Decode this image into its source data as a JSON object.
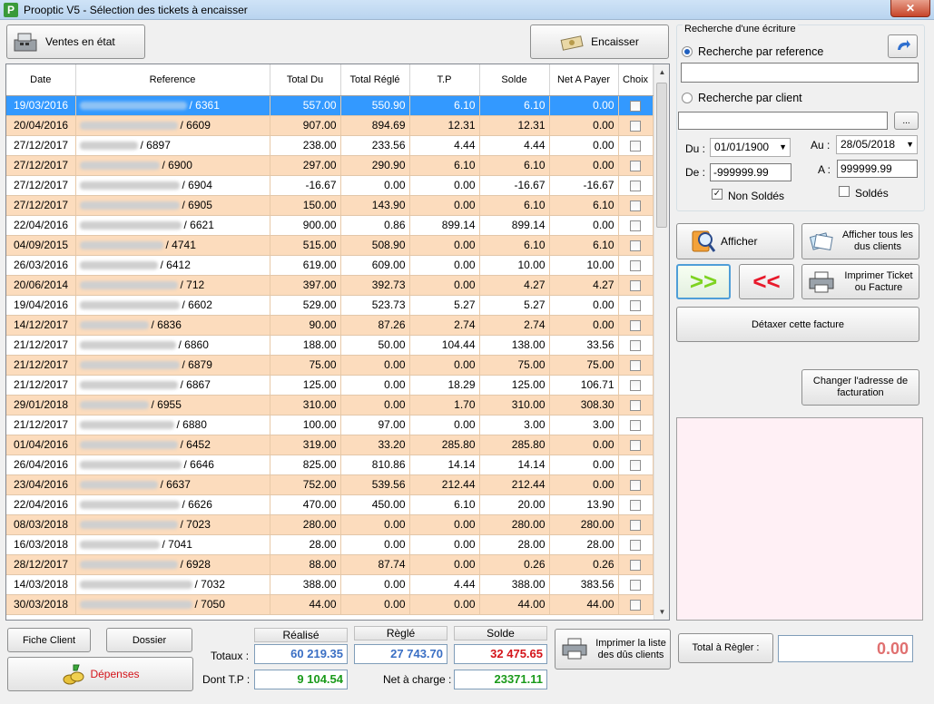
{
  "window": {
    "title": "Prooptic V5 - Sélection des tickets à encaisser",
    "app_icon": "P",
    "close": "✕"
  },
  "buttons": {
    "ventes_en_etat": "Ventes en état",
    "encaisser": "Encaisser",
    "afficher": "Afficher",
    "afficher_tous": "Afficher tous les dus clients",
    "forward": ">>",
    "back": "<<",
    "imprimer_ticket": "Imprimer Ticket ou Facture",
    "detaxer": "Détaxer cette facture",
    "changer_adresse": "Changer l'adresse de facturation",
    "fiche_client": "Fiche Client",
    "dossier": "Dossier",
    "depenses": "Dépenses",
    "imprimer_liste": "Imprimer la liste des dûs clients",
    "browse": "..."
  },
  "grid": {
    "columns": [
      "Date",
      "Reference",
      "Total Du",
      "Total Réglé",
      "T.P",
      "Solde",
      "Net A Payer",
      "Choix"
    ],
    "rows": [
      {
        "date": "19/03/2016",
        "ref": "/ 6361",
        "total_du": "557.00",
        "total_regle": "550.90",
        "tp": "6.10",
        "solde": "6.10",
        "net": "0.00"
      },
      {
        "date": "20/04/2016",
        "ref": "/ 6609",
        "total_du": "907.00",
        "total_regle": "894.69",
        "tp": "12.31",
        "solde": "12.31",
        "net": "0.00"
      },
      {
        "date": "27/12/2017",
        "ref": "/ 6897",
        "total_du": "238.00",
        "total_regle": "233.56",
        "tp": "4.44",
        "solde": "4.44",
        "net": "0.00"
      },
      {
        "date": "27/12/2017",
        "ref": "/ 6900",
        "total_du": "297.00",
        "total_regle": "290.90",
        "tp": "6.10",
        "solde": "6.10",
        "net": "0.00"
      },
      {
        "date": "27/12/2017",
        "ref": "/ 6904",
        "total_du": "-16.67",
        "total_regle": "0.00",
        "tp": "0.00",
        "solde": "-16.67",
        "net": "-16.67"
      },
      {
        "date": "27/12/2017",
        "ref": "/ 6905",
        "total_du": "150.00",
        "total_regle": "143.90",
        "tp": "0.00",
        "solde": "6.10",
        "net": "6.10"
      },
      {
        "date": "22/04/2016",
        "ref": "/ 6621",
        "total_du": "900.00",
        "total_regle": "0.86",
        "tp": "899.14",
        "solde": "899.14",
        "net": "0.00"
      },
      {
        "date": "04/09/2015",
        "ref": "/ 4741",
        "total_du": "515.00",
        "total_regle": "508.90",
        "tp": "0.00",
        "solde": "6.10",
        "net": "6.10"
      },
      {
        "date": "26/03/2016",
        "ref": "/ 6412",
        "total_du": "619.00",
        "total_regle": "609.00",
        "tp": "0.00",
        "solde": "10.00",
        "net": "10.00"
      },
      {
        "date": "20/06/2014",
        "ref": "/ 712",
        "total_du": "397.00",
        "total_regle": "392.73",
        "tp": "0.00",
        "solde": "4.27",
        "net": "4.27"
      },
      {
        "date": "19/04/2016",
        "ref": "/ 6602",
        "total_du": "529.00",
        "total_regle": "523.73",
        "tp": "5.27",
        "solde": "5.27",
        "net": "0.00"
      },
      {
        "date": "14/12/2017",
        "ref": "/ 6836",
        "total_du": "90.00",
        "total_regle": "87.26",
        "tp": "2.74",
        "solde": "2.74",
        "net": "0.00"
      },
      {
        "date": "21/12/2017",
        "ref": "/ 6860",
        "total_du": "188.00",
        "total_regle": "50.00",
        "tp": "104.44",
        "solde": "138.00",
        "net": "33.56"
      },
      {
        "date": "21/12/2017",
        "ref": "/ 6879",
        "total_du": "75.00",
        "total_regle": "0.00",
        "tp": "0.00",
        "solde": "75.00",
        "net": "75.00"
      },
      {
        "date": "21/12/2017",
        "ref": "/ 6867",
        "total_du": "125.00",
        "total_regle": "0.00",
        "tp": "18.29",
        "solde": "125.00",
        "net": "106.71"
      },
      {
        "date": "29/01/2018",
        "ref": "/ 6955",
        "total_du": "310.00",
        "total_regle": "0.00",
        "tp": "1.70",
        "solde": "310.00",
        "net": "308.30"
      },
      {
        "date": "21/12/2017",
        "ref": "/ 6880",
        "total_du": "100.00",
        "total_regle": "97.00",
        "tp": "0.00",
        "solde": "3.00",
        "net": "3.00"
      },
      {
        "date": "01/04/2016",
        "ref": "/ 6452",
        "total_du": "319.00",
        "total_regle": "33.20",
        "tp": "285.80",
        "solde": "285.80",
        "net": "0.00"
      },
      {
        "date": "26/04/2016",
        "ref": "/ 6646",
        "total_du": "825.00",
        "total_regle": "810.86",
        "tp": "14.14",
        "solde": "14.14",
        "net": "0.00"
      },
      {
        "date": "23/04/2016",
        "ref": "/ 6637",
        "total_du": "752.00",
        "total_regle": "539.56",
        "tp": "212.44",
        "solde": "212.44",
        "net": "0.00"
      },
      {
        "date": "22/04/2016",
        "ref": "/ 6626",
        "total_du": "470.00",
        "total_regle": "450.00",
        "tp": "6.10",
        "solde": "20.00",
        "net": "13.90"
      },
      {
        "date": "08/03/2018",
        "ref": "/ 7023",
        "total_du": "280.00",
        "total_regle": "0.00",
        "tp": "0.00",
        "solde": "280.00",
        "net": "280.00"
      },
      {
        "date": "16/03/2018",
        "ref": "/ 7041",
        "total_du": "28.00",
        "total_regle": "0.00",
        "tp": "0.00",
        "solde": "28.00",
        "net": "28.00"
      },
      {
        "date": "28/12/2017",
        "ref": "/ 6928",
        "total_du": "88.00",
        "total_regle": "87.74",
        "tp": "0.00",
        "solde": "0.26",
        "net": "0.26"
      },
      {
        "date": "14/03/2018",
        "ref": "/ 7032",
        "total_du": "388.00",
        "total_regle": "0.00",
        "tp": "4.44",
        "solde": "388.00",
        "net": "383.56"
      },
      {
        "date": "30/03/2018",
        "ref": "/ 7050",
        "total_du": "44.00",
        "total_regle": "0.00",
        "tp": "0.00",
        "solde": "44.00",
        "net": "44.00"
      }
    ]
  },
  "search": {
    "group_title": "Recherche d'une écriture",
    "by_reference": "Recherche par reference",
    "by_client": "Recherche par client",
    "reference_value": "",
    "client_value": "",
    "du_label": "Du :",
    "du_value": "01/01/1900",
    "au_label": "Au :",
    "au_value": "28/05/2018",
    "de_label": "De :",
    "de_value": "-999999.99",
    "a_label": "A :",
    "a_value": "999999.99",
    "non_soldes": "Non Soldés",
    "non_soldes_checked": "✓",
    "soldes": "Soldés"
  },
  "totals": {
    "realise_label": "Réalisé",
    "regle_label": "Règlé",
    "solde_label": "Solde",
    "totaux_label": "Totaux :",
    "realise_value": "60 219.35",
    "regle_value": "27 743.70",
    "solde_value": "32 475.65",
    "dont_tp_label": "Dont T.P :",
    "dont_tp_value": "9 104.54",
    "net_charge_label": "Net à charge :",
    "net_charge_value": "23371.11",
    "total_a_regler_label": "Total à Règler :",
    "total_a_regler_value": "0.00"
  },
  "colors": {
    "row_odd": "#fcdcbd",
    "selected": "#3399ff",
    "blue_text": "#3a6fc4",
    "red_text": "#d4141a",
    "green_text": "#1a9a1a"
  }
}
